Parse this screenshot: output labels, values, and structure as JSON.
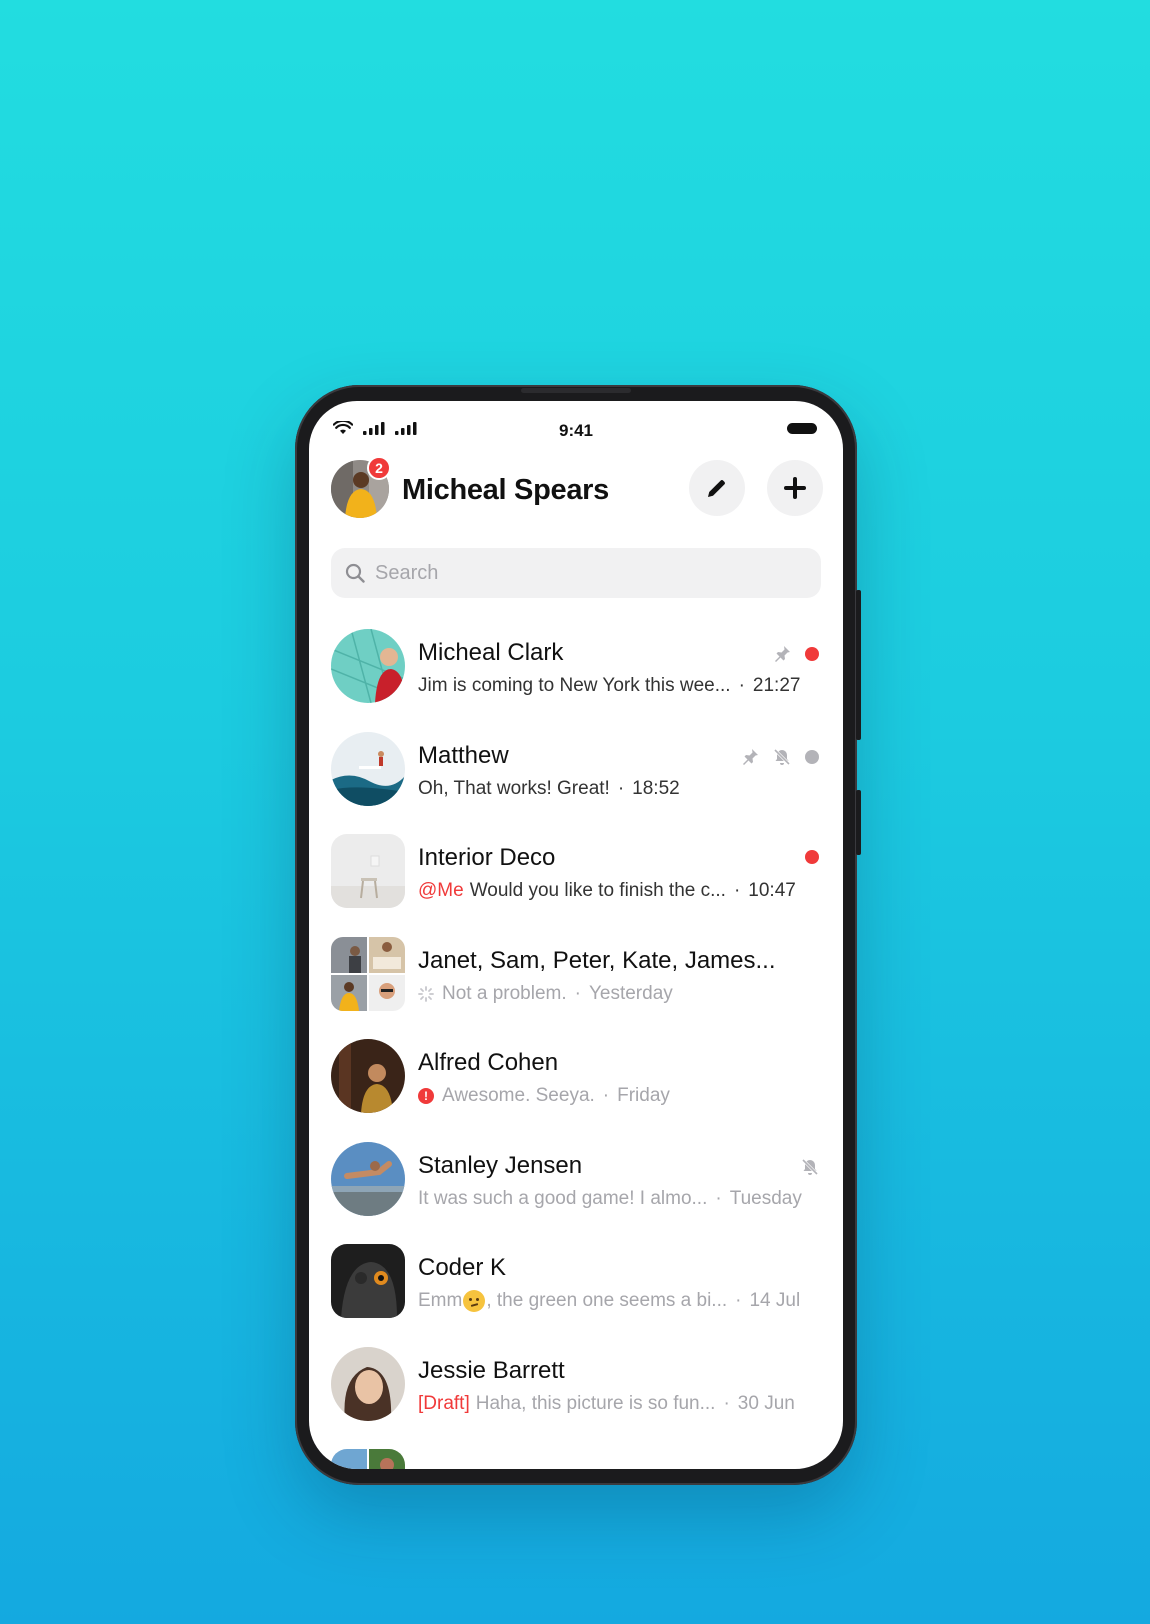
{
  "status_bar": {
    "time": "9:41"
  },
  "header": {
    "user_name": "Micheal Spears",
    "badge_count": "2"
  },
  "search": {
    "placeholder": "Search"
  },
  "colors": {
    "accent_red": "#f03a3a",
    "muted_gray": "#b3b3b8",
    "background_top": "#22dde0",
    "background_bottom": "#14a9e0"
  },
  "conversations": [
    {
      "name": "Micheal Clark",
      "prefix": "",
      "message": "Jim is coming to New York this wee...",
      "time": "21:27",
      "icons": [
        "pin-icon"
      ],
      "dot": "unread-red"
    },
    {
      "name": "Matthew",
      "prefix": "",
      "message": "Oh, That works! Great!",
      "time": "18:52",
      "icons": [
        "pin-icon",
        "mute-icon"
      ],
      "dot": "read-gray"
    },
    {
      "name": "Interior Deco",
      "prefix": "@Me",
      "message": "Would you like to finish the c...",
      "time": "10:47",
      "icons": [],
      "dot": "unread-red"
    },
    {
      "name": "Janet, Sam, Peter, Kate, James...",
      "prefix": "",
      "message": "Not a problem.",
      "time": "Yesterday",
      "icons": [],
      "dot": "",
      "status": "sending"
    },
    {
      "name": "Alfred Cohen",
      "prefix": "",
      "message": "Awesome. Seeya.",
      "time": "Friday",
      "icons": [],
      "dot": "",
      "status": "failed"
    },
    {
      "name": "Stanley Jensen",
      "prefix": "",
      "message": "It was such a good game! I almo...",
      "time": "Tuesday",
      "icons": [
        "mute-icon"
      ],
      "dot": ""
    },
    {
      "name": "Coder K",
      "prefix": "",
      "message_a": "Emm",
      "message_b": ", the green one seems a bi...",
      "time": "14 Jul",
      "icons": [],
      "dot": ""
    },
    {
      "name": "Jessie Barrett",
      "prefix": "[Draft]",
      "message": "Haha, this picture is so fun...",
      "time": "30 Jun",
      "icons": [],
      "dot": ""
    }
  ]
}
